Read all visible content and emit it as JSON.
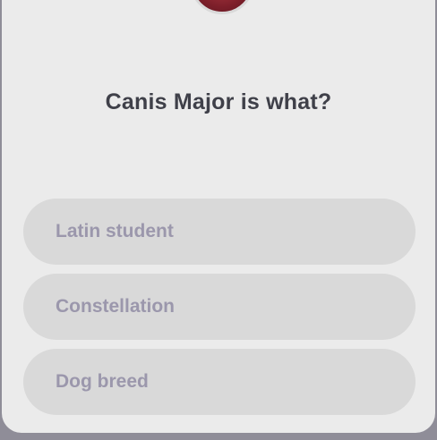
{
  "quiz": {
    "question": "Canis Major is what?",
    "options": [
      {
        "label": "Latin student"
      },
      {
        "label": "Constellation"
      },
      {
        "label": "Dog breed"
      }
    ]
  },
  "colors": {
    "background": "#8f8d98",
    "card": "#ebebeb",
    "option_bg": "#d9d9d9",
    "option_text": "#9b97ac",
    "question_text": "#3f4049"
  },
  "icons": {
    "avatar": "profile-avatar"
  }
}
